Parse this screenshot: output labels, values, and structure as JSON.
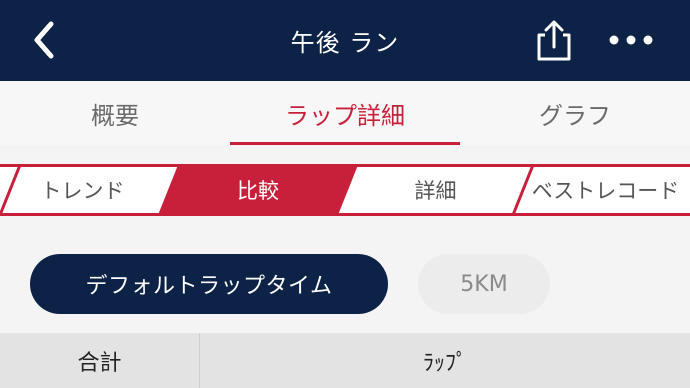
{
  "header": {
    "title": "午後 ラン",
    "back_icon": "chevron-left-icon",
    "share_icon": "share-icon",
    "more_icon": "more-horizontal-icon"
  },
  "tabs": [
    {
      "label": "概要",
      "active": false
    },
    {
      "label": "ラップ詳細",
      "active": true
    },
    {
      "label": "グラフ",
      "active": false
    }
  ],
  "segments": [
    {
      "label": "トレンド",
      "active": false
    },
    {
      "label": "比較",
      "active": true
    },
    {
      "label": "詳細",
      "active": false
    },
    {
      "label": "ベストレコード",
      "active": false
    }
  ],
  "filters": {
    "primary_label": "デフォルトラップタイム",
    "secondary_label": "5KM"
  },
  "table": {
    "col_total": "合計",
    "col_lap": "ﾗｯﾌﾟ"
  },
  "colors": {
    "navy": "#0c2247",
    "accent_red": "#c8203a",
    "background": "#f4f4f4"
  }
}
